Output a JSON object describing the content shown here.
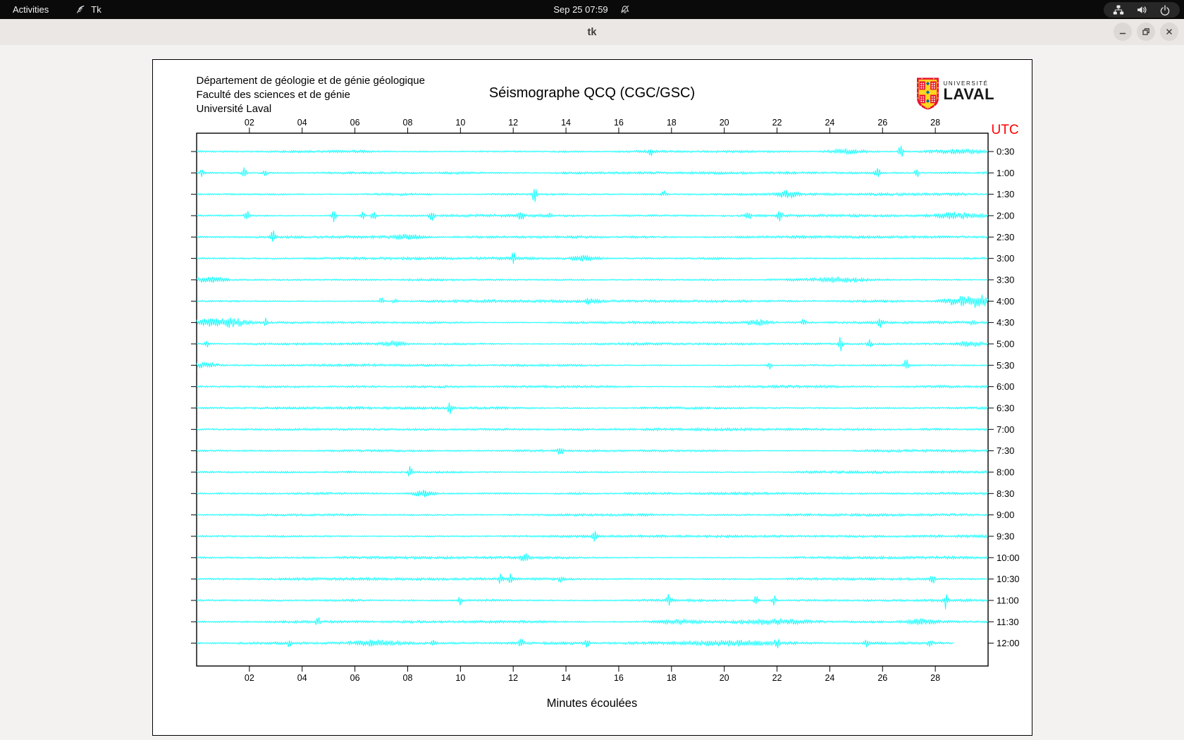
{
  "topbar": {
    "activities": "Activities",
    "app_name": "Tk",
    "clock": "Sep 25 07:59"
  },
  "titlebar": {
    "title": "tk"
  },
  "canvas": {
    "header_lines": [
      "Département de géologie et de génie géologique",
      "Faculté des sciences et de génie",
      "Université Laval"
    ],
    "title": "Séismographe QCQ (CGC/GSC)",
    "logo": {
      "line1": "UNIVERSITÉ",
      "line2": "LAVAL"
    },
    "utc_label": "UTC",
    "xlabel": "Minutes écoulées"
  },
  "colors": {
    "trace": "#00ffff",
    "utc_label": "#ff0000",
    "logo_red": "#e8112d",
    "logo_gold": "#ffd520",
    "logo_blue": "#0067b1"
  },
  "chart_data": {
    "type": "line",
    "title": "Séismographe QCQ (CGC/GSC)",
    "xlabel": "Minutes écoulées",
    "x_range": [
      0,
      30
    ],
    "x_ticks": [
      "02",
      "04",
      "06",
      "08",
      "10",
      "12",
      "14",
      "16",
      "18",
      "20",
      "22",
      "24",
      "26",
      "28"
    ],
    "right_axis_label": "UTC",
    "trace_color": "#00ffff",
    "grid": false,
    "rows": [
      {
        "utc": "0:30",
        "end": 30,
        "events": [
          [
            17.2,
            6
          ],
          [
            24.6,
            3.5,
            0.5
          ],
          [
            26.7,
            11
          ],
          [
            28.9,
            2.8,
            0.8
          ]
        ]
      },
      {
        "utc": "1:00",
        "end": 30,
        "events": [
          [
            0.2,
            5
          ],
          [
            1.8,
            7
          ],
          [
            2.6,
            4
          ],
          [
            25.8,
            10
          ],
          [
            27.3,
            6
          ]
        ]
      },
      {
        "utc": "1:30",
        "end": 30,
        "events": [
          [
            12.8,
            12
          ],
          [
            17.7,
            5
          ],
          [
            22.4,
            5,
            0.25
          ]
        ]
      },
      {
        "utc": "2:00",
        "end": 30,
        "events": [
          [
            1.9,
            8
          ],
          [
            5.2,
            10
          ],
          [
            6.3,
            9
          ],
          [
            6.7,
            9
          ],
          [
            8.9,
            10
          ],
          [
            12.3,
            9
          ],
          [
            13.4,
            5
          ],
          [
            20.9,
            9
          ],
          [
            22.1,
            9
          ],
          [
            28.8,
            3.5,
            0.6
          ]
        ]
      },
      {
        "utc": "2:30",
        "end": 30,
        "events": [
          [
            2.9,
            10
          ],
          [
            8.0,
            3.5,
            0.4
          ]
        ]
      },
      {
        "utc": "3:00",
        "end": 30,
        "events": [
          [
            12.0,
            8
          ],
          [
            14.7,
            3.5,
            0.35
          ]
        ]
      },
      {
        "utc": "3:30",
        "end": 30,
        "events": [
          [
            0.5,
            3.5,
            0.4
          ],
          [
            24.3,
            2.8,
            0.5
          ]
        ]
      },
      {
        "utc": "4:00",
        "end": 30,
        "events": [
          [
            7.0,
            5
          ],
          [
            7.5,
            4
          ],
          [
            14.9,
            3.5,
            0.2
          ],
          [
            28.9,
            6,
            0.45
          ],
          [
            29.6,
            9,
            0.3
          ]
        ]
      },
      {
        "utc": "4:30",
        "end": 30,
        "events": [
          [
            0.4,
            5,
            0.5
          ],
          [
            1.4,
            6,
            0.35
          ],
          [
            2.6,
            6
          ],
          [
            21.3,
            4,
            0.3
          ],
          [
            23.0,
            5
          ],
          [
            25.9,
            10
          ],
          [
            29.4,
            4
          ]
        ]
      },
      {
        "utc": "5:00",
        "end": 30,
        "events": [
          [
            0.4,
            5
          ],
          [
            7.5,
            3.5,
            0.3
          ],
          [
            24.4,
            11
          ],
          [
            25.5,
            9
          ],
          [
            29.3,
            4,
            0.3
          ]
        ]
      },
      {
        "utc": "5:30",
        "end": 30,
        "events": [
          [
            0.3,
            4,
            0.3
          ],
          [
            21.7,
            6
          ],
          [
            26.9,
            9
          ]
        ]
      },
      {
        "utc": "6:00",
        "end": 30,
        "events": []
      },
      {
        "utc": "6:30",
        "end": 30,
        "events": [
          [
            9.6,
            8
          ]
        ]
      },
      {
        "utc": "7:00",
        "end": 30,
        "events": []
      },
      {
        "utc": "7:30",
        "end": 30,
        "events": [
          [
            13.8,
            9
          ]
        ]
      },
      {
        "utc": "8:00",
        "end": 30,
        "events": [
          [
            8.1,
            9
          ]
        ]
      },
      {
        "utc": "8:30",
        "end": 30,
        "events": [
          [
            8.6,
            4.5,
            0.25
          ]
        ]
      },
      {
        "utc": "9:00",
        "end": 30,
        "events": []
      },
      {
        "utc": "9:30",
        "end": 30,
        "events": [
          [
            15.1,
            8
          ]
        ]
      },
      {
        "utc": "10:00",
        "end": 30,
        "events": [
          [
            12.4,
            6,
            0.12
          ]
        ]
      },
      {
        "utc": "10:30",
        "end": 30,
        "events": [
          [
            11.5,
            7
          ],
          [
            11.9,
            6
          ],
          [
            13.8,
            5
          ],
          [
            27.9,
            6
          ]
        ]
      },
      {
        "utc": "11:00",
        "end": 30,
        "events": [
          [
            10.0,
            7
          ],
          [
            17.9,
            9
          ],
          [
            21.2,
            7
          ],
          [
            21.9,
            7
          ],
          [
            28.4,
            12
          ]
        ]
      },
      {
        "utc": "11:30",
        "end": 30,
        "events": [
          [
            4.6,
            7
          ],
          [
            18.2,
            3.5,
            0.5
          ],
          [
            21.9,
            3.5,
            0.8
          ],
          [
            27.5,
            3.5,
            0.4
          ]
        ]
      },
      {
        "utc": "12:00",
        "end": 28.7,
        "events": [
          [
            3.5,
            4
          ],
          [
            6.8,
            3.5,
            0.6
          ],
          [
            9.0,
            5
          ],
          [
            12.3,
            6
          ],
          [
            14.8,
            7
          ],
          [
            20.5,
            3.5,
            1.2
          ],
          [
            22.0,
            6
          ],
          [
            25.4,
            5
          ],
          [
            27.8,
            4
          ]
        ]
      }
    ]
  }
}
